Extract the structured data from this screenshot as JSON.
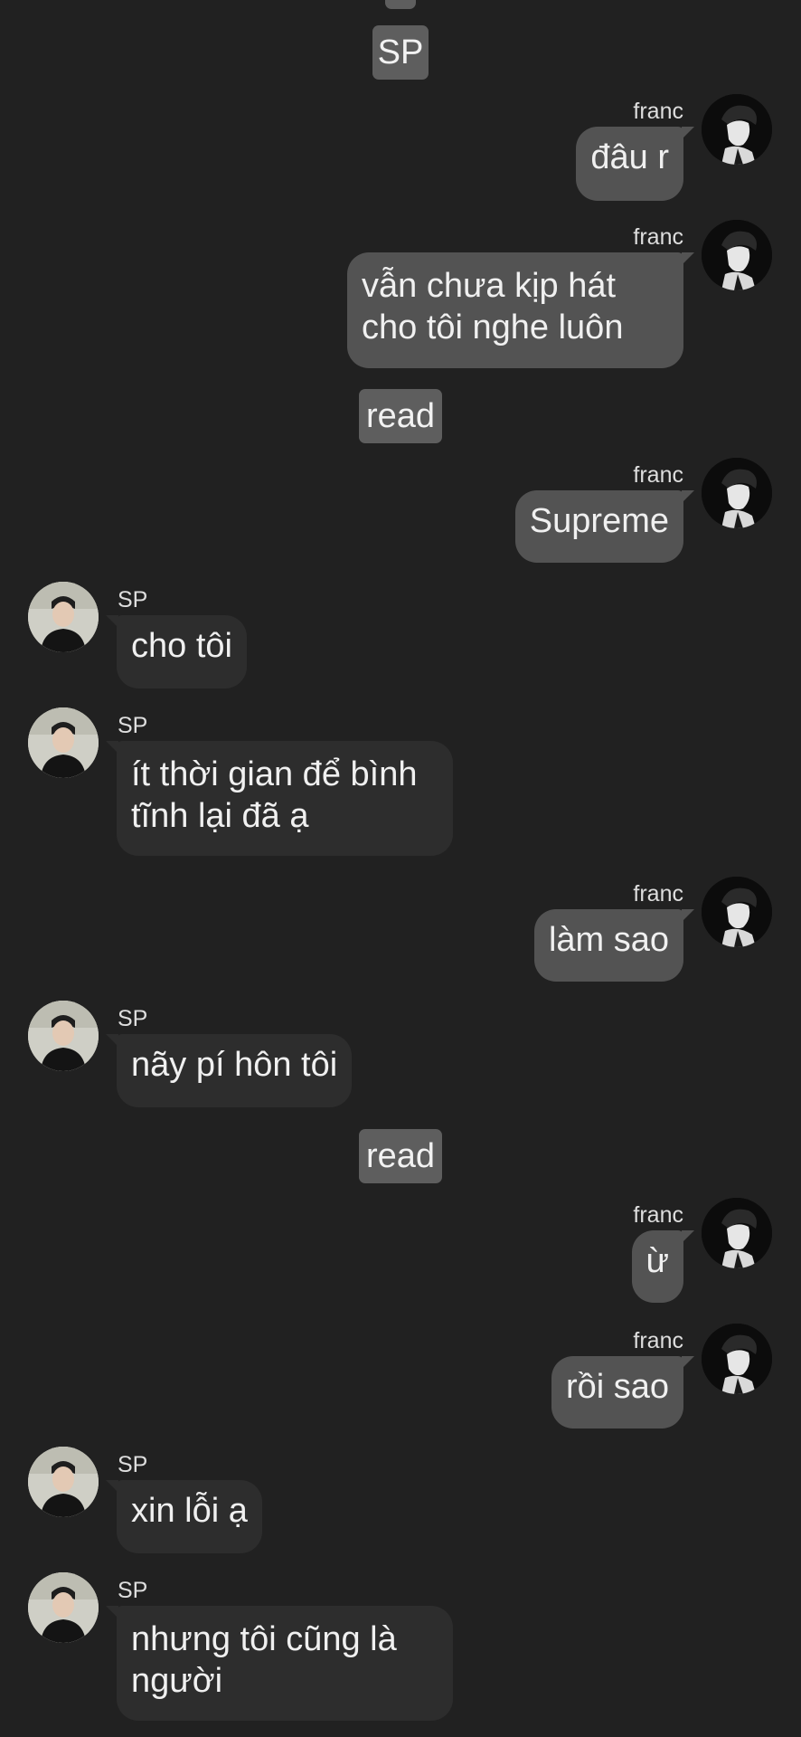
{
  "system_chips": {
    "top_partial": "",
    "sp": "SP",
    "read_1": "read",
    "read_2": "read"
  },
  "senders": {
    "franc": "franc",
    "sp": "SP"
  },
  "messages": [
    {
      "from": "franc",
      "text": "đâu r"
    },
    {
      "from": "franc",
      "text": "vẫn chưa kịp hát cho tôi nghe luôn"
    },
    {
      "from": "franc",
      "text": "Supreme"
    },
    {
      "from": "sp",
      "text": "cho tôi"
    },
    {
      "from": "sp",
      "text": "ít thời gian để bình tĩnh lại đã ạ"
    },
    {
      "from": "franc",
      "text": "làm sao"
    },
    {
      "from": "sp",
      "text": "nãy pí hôn tôi"
    },
    {
      "from": "franc",
      "text": "ừ"
    },
    {
      "from": "franc",
      "text": "rồi sao"
    },
    {
      "from": "sp",
      "text": "xin lỗi ạ"
    },
    {
      "from": "sp",
      "text": "nhưng tôi cũng là người"
    }
  ],
  "colors": {
    "background": "#212121",
    "outgoing_bubble": "#535353",
    "incoming_bubble": "#2d2d2d",
    "system_chip": "#5e5e5e"
  },
  "icons": {
    "franc_avatar": "avatar-franc",
    "sp_avatar": "avatar-sp"
  }
}
